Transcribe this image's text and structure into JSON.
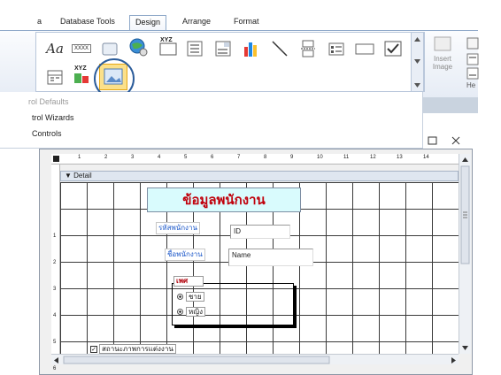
{
  "ribbon": {
    "tabs": [
      {
        "label": "a"
      },
      {
        "label": "Database Tools"
      },
      {
        "label": "Design"
      },
      {
        "label": "Arrange"
      },
      {
        "label": "Format"
      }
    ],
    "active_tab": "Design",
    "controls": {
      "label_control": "Aa",
      "textbox_control": "XXXX",
      "label_xyz": "XYZ",
      "insert_image_line1": "Insert",
      "insert_image_line2": "Image",
      "he_label": "He"
    },
    "menu": {
      "control_defaults": "rol Defaults",
      "control_wizards": "trol Wizards",
      "controls": "Controls"
    }
  },
  "design": {
    "section": "Detail",
    "ruler_marks": [
      "1",
      "2",
      "3",
      "4",
      "5",
      "6",
      "7",
      "8",
      "9",
      "10",
      "11",
      "12",
      "13",
      "14"
    ],
    "left_ruler_marks": [
      "1",
      "2",
      "3",
      "4",
      "5",
      "6"
    ],
    "title": "ข้อมูลพนักงาน",
    "emp_id_label": "รหัสพนักงาน",
    "emp_id_field": "ID",
    "emp_name_label": "ชื่อพนักงาน",
    "emp_name_field": "Name",
    "gender_label": "เพศ",
    "gender_male": "ชาย",
    "gender_female": "หญิง",
    "status_checkbox": "สถานะภาพการแต่งงาน"
  }
}
